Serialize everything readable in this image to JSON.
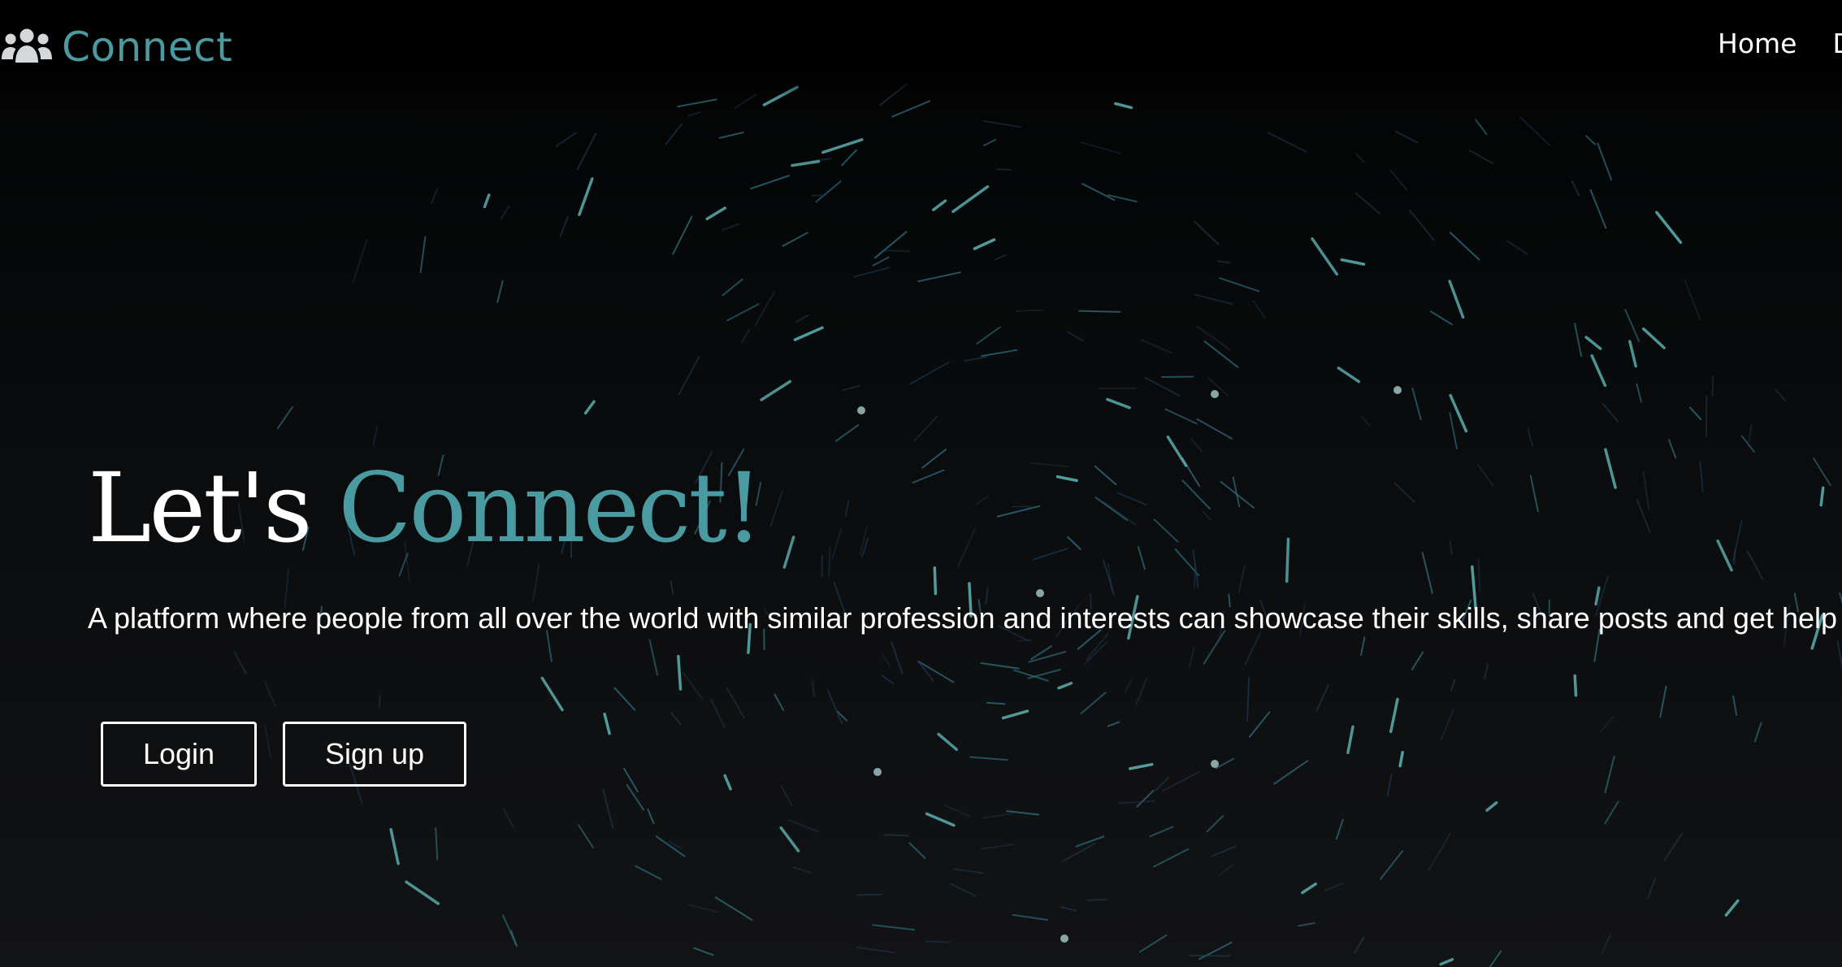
{
  "navbar": {
    "brand_icon": "users-icon",
    "brand_name": "Connect",
    "links": [
      {
        "label": "Home"
      },
      {
        "label": "Developers"
      }
    ]
  },
  "hero": {
    "title_part1": "Let's ",
    "title_part2": "Connect!",
    "subtitle": "A platform where people from all over the world with similar profession and interests can showcase their skills, share posts and get help",
    "login_label": "Login",
    "signup_label": "Sign up"
  },
  "colors": {
    "accent": "#4a9aa1",
    "text": "#ffffff",
    "background": "#0b0c0d"
  }
}
